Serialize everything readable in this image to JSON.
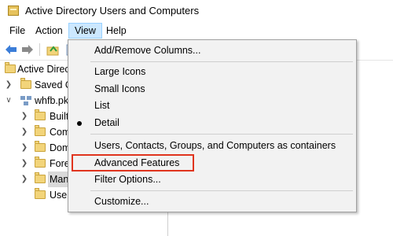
{
  "window": {
    "title": "Active Directory Users and Computers"
  },
  "menubar": {
    "file": "File",
    "action": "Action",
    "view": "View",
    "help": "Help"
  },
  "toolbar": {
    "back_icon": "back-arrow-icon",
    "forward_icon": "forward-arrow-icon",
    "up_icon": "up-folder-icon",
    "list_icon": "show-list-icon"
  },
  "tree": {
    "root": "Active Directory",
    "saved_queries": "Saved Q",
    "domain": "whfb.pk",
    "children": [
      "Built",
      "Com",
      "Dom",
      "Fore",
      "Man",
      "User"
    ]
  },
  "view_menu": {
    "add_remove_columns": "Add/Remove Columns...",
    "large_icons": "Large Icons",
    "small_icons": "Small Icons",
    "list": "List",
    "detail": "Detail",
    "detail_selected": true,
    "users_contacts": "Users, Contacts, Groups, and Computers as containers",
    "advanced_features": "Advanced Features",
    "filter_options": "Filter Options...",
    "customize": "Customize..."
  },
  "colors": {
    "menu_highlight": "#cce8ff",
    "annotation_red": "#e0341e",
    "folder": "#f2d47a"
  }
}
